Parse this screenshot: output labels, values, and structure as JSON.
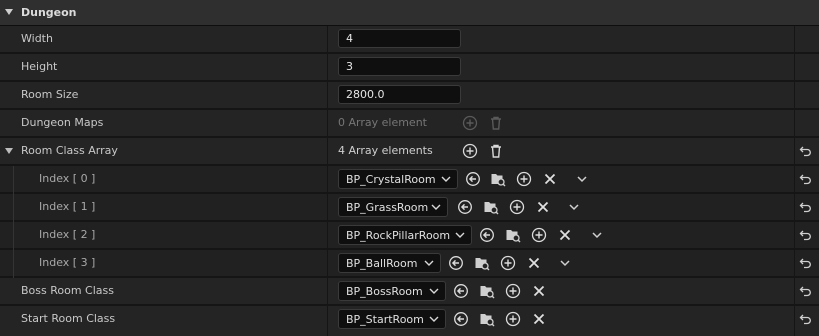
{
  "section": {
    "title": "Dungeon"
  },
  "rows": {
    "width": {
      "label": "Width",
      "value": "4"
    },
    "height": {
      "label": "Height",
      "value": "3"
    },
    "room_size": {
      "label": "Room Size",
      "value": "2800.0"
    },
    "dungeon_maps": {
      "label": "Dungeon Maps",
      "summary": "0 Array element"
    },
    "room_class_array": {
      "label": "Room Class Array",
      "summary": "4 Array elements",
      "items": [
        {
          "label": "Index [ 0 ]",
          "value": "BP_CrystalRoom"
        },
        {
          "label": "Index [ 1 ]",
          "value": "BP_GrassRoom"
        },
        {
          "label": "Index [ 2 ]",
          "value": "BP_RockPillarRoom"
        },
        {
          "label": "Index [ 3 ]",
          "value": "BP_BallRoom"
        }
      ]
    },
    "boss_room_class": {
      "label": "Boss Room Class",
      "value": "BP_BossRoom"
    },
    "start_room_class": {
      "label": "Start Room Class",
      "value": "BP_StartRoom"
    }
  },
  "icons": {
    "add": "plus-circle-icon",
    "remove_all": "trash-icon",
    "use_selected": "arrow-left-circle-icon",
    "browse": "folder-search-icon",
    "insert": "plus-circle-icon",
    "clear": "x-icon",
    "more": "chevron-down-icon",
    "reset": "reset-arrow-icon"
  },
  "colors": {
    "background": "#151515",
    "row": "#242424",
    "header": "#2f2f2f",
    "input": "#0f0f0f"
  }
}
